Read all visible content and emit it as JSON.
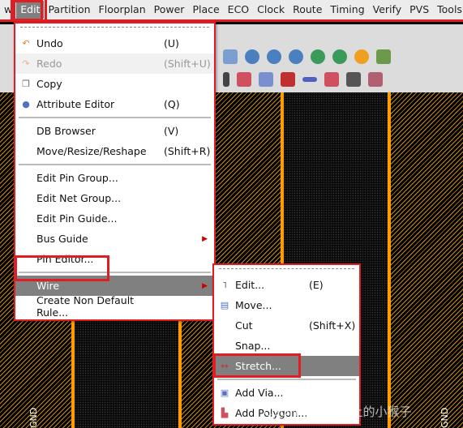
{
  "menubar": {
    "items": [
      "w",
      "Edit",
      "Partition",
      "Floorplan",
      "Power",
      "Place",
      "ECO",
      "Clock",
      "Route",
      "Timing",
      "Verify",
      "PVS",
      "Tools"
    ],
    "active": "Edit"
  },
  "edit_menu": {
    "items": [
      {
        "label": "Undo",
        "shortcut": "(U)",
        "icon": "undo-icon"
      },
      {
        "label": "Redo",
        "shortcut": "(Shift+U)",
        "icon": "redo-icon",
        "disabled": true
      },
      {
        "label": "Copy",
        "shortcut": "",
        "icon": "copy-icon"
      },
      {
        "label": "Attribute Editor",
        "shortcut": "(Q)",
        "icon": "attribute-icon"
      },
      {
        "label": "DB Browser",
        "shortcut": "(V)",
        "icon": ""
      },
      {
        "label": "Move/Resize/Reshape",
        "shortcut": "(Shift+R)",
        "icon": ""
      },
      {
        "label": "Edit Pin Group...",
        "shortcut": "",
        "icon": ""
      },
      {
        "label": "Edit Net Group...",
        "shortcut": "",
        "icon": ""
      },
      {
        "label": "Edit Pin Guide...",
        "shortcut": "",
        "icon": ""
      },
      {
        "label": "Bus Guide",
        "shortcut": "",
        "icon": "",
        "submenu": true
      },
      {
        "label": "Pin Editor...",
        "shortcut": "",
        "icon": ""
      },
      {
        "label": "Wire",
        "shortcut": "",
        "icon": "",
        "submenu": true,
        "highlighted": true
      },
      {
        "label": "Create Non Default Rule...",
        "shortcut": "",
        "icon": ""
      }
    ]
  },
  "wire_submenu": {
    "items": [
      {
        "label": "Edit...",
        "shortcut": "(E)",
        "icon": "edit-wire-icon"
      },
      {
        "label": "Move...",
        "shortcut": "",
        "icon": "move-icon"
      },
      {
        "label": "Cut",
        "shortcut": "(Shift+X)",
        "icon": ""
      },
      {
        "label": "Snap...",
        "shortcut": "",
        "icon": ""
      },
      {
        "label": "Stretch...",
        "shortcut": "",
        "icon": "stretch-icon",
        "highlighted": true
      },
      {
        "label": "Add Via...",
        "shortcut": "",
        "icon": "add-via-icon"
      },
      {
        "label": "Add Polygon...",
        "shortcut": "",
        "icon": "add-polygon-icon"
      }
    ]
  },
  "canvas": {
    "net_label": "GND"
  },
  "watermark": "CSDN @时钟树上的小猴子",
  "colors": {
    "highlight_box": "#e11d24",
    "wire": "#ff9d00",
    "menu_highlight": "#808080"
  }
}
